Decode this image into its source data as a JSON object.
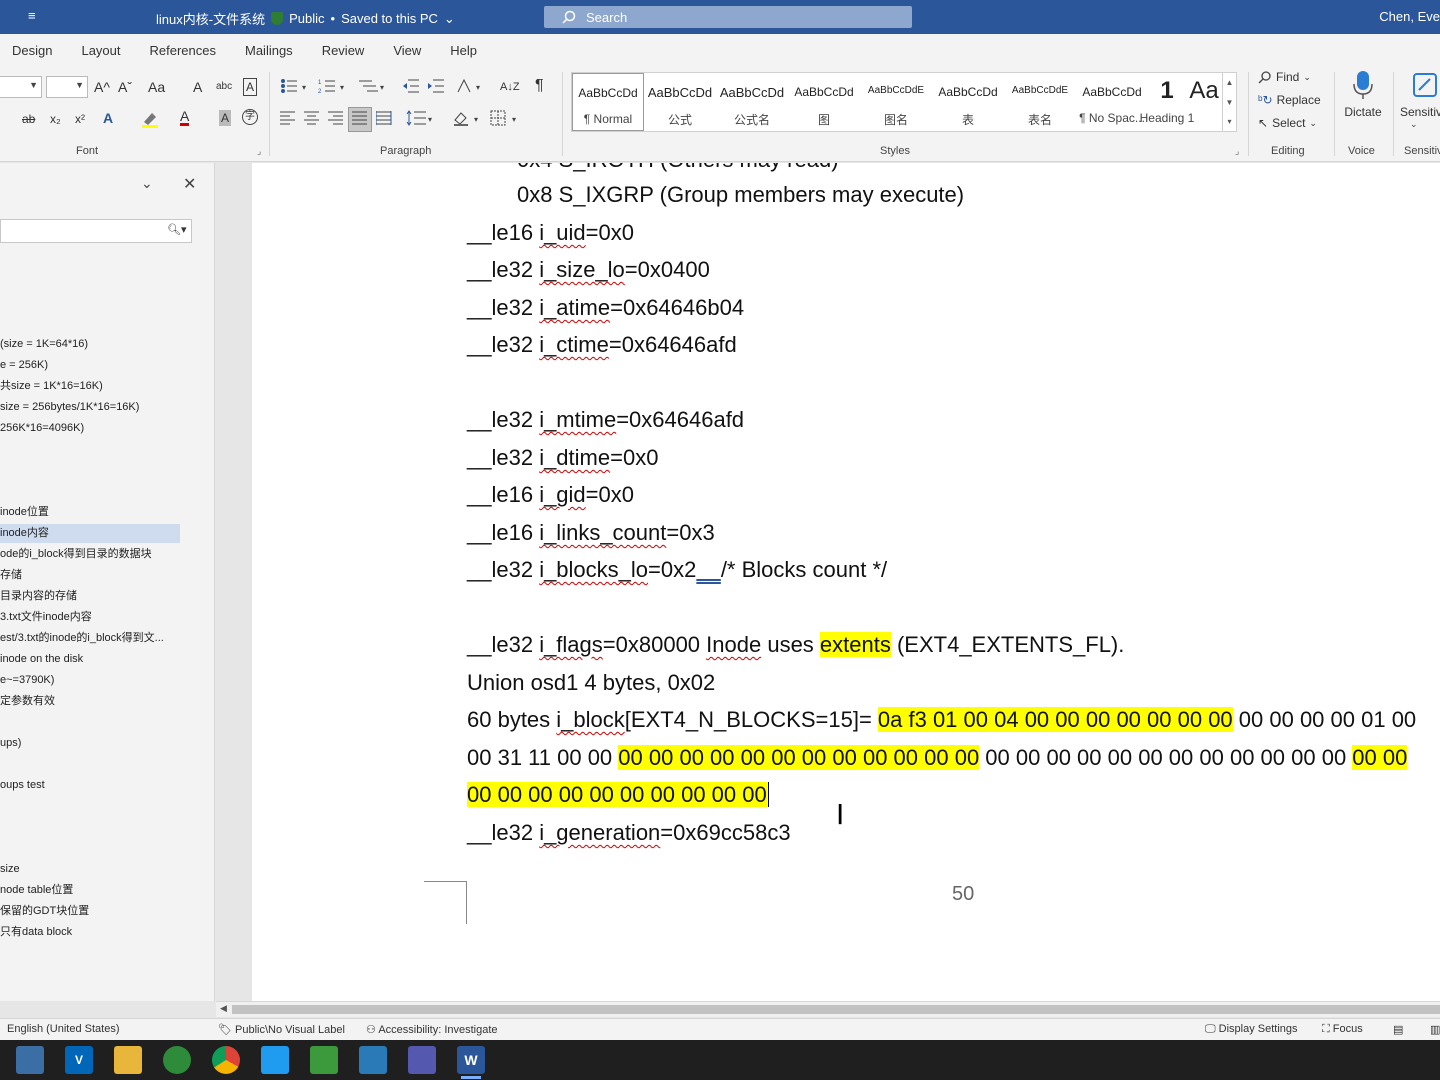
{
  "titlebar": {
    "menu_glyph": "≡",
    "doc_title": "linux内核-文件系统",
    "sensitivity": "Public",
    "save_status": "Saved to this PC",
    "search_placeholder": "Search",
    "user": "Chen, Eve"
  },
  "tabs": [
    "Design",
    "Layout",
    "References",
    "Mailings",
    "Review",
    "View",
    "Help"
  ],
  "ribbon": {
    "groups": {
      "font": "Font",
      "paragraph": "Paragraph",
      "styles": "Styles",
      "editing": "Editing",
      "voice": "Voice",
      "sensitivity": "Sensitivity"
    },
    "font_buttons": {
      "grow": "A^",
      "shrink": "Aˇ",
      "case": "Aa",
      "clear": "A",
      "phonetic": "abc",
      "border": "A",
      "strike": "ab",
      "sub": "x₂",
      "sup": "x²",
      "effects": "A",
      "color": "A",
      "shade": "A",
      "enclose": "字"
    },
    "paragraph_buttons": {
      "sort": "A↓Z",
      "pilcrow": "¶"
    },
    "styles": [
      {
        "preview": "AaBbCcDd",
        "name": "¶ Normal"
      },
      {
        "preview": "AaBbCcDd",
        "name": "公式"
      },
      {
        "preview": "AaBbCcDd",
        "name": "公式名"
      },
      {
        "preview": "AaBbCcDd",
        "name": "图"
      },
      {
        "preview": "AaBbCcDdE",
        "name": "图名"
      },
      {
        "preview": "AaBbCcDd",
        "name": "表"
      },
      {
        "preview": "AaBbCcDdE",
        "name": "表名"
      },
      {
        "preview": "AaBbCcDd",
        "name": "¶ No Spac..."
      },
      {
        "preview": "1",
        "name": "Heading 1"
      },
      {
        "preview": "Aa",
        "name": ""
      }
    ],
    "editing": {
      "find": "Find",
      "replace": "Replace",
      "select": "Select"
    },
    "voice": {
      "dictate": "Dictate"
    },
    "sensitivity_label": "Sensitiv"
  },
  "navpane": {
    "items": [
      {
        "text": "(size = 1K=64*16)"
      },
      {
        "text": "e = 256K)"
      },
      {
        "text": "共size = 1K*16=16K)"
      },
      {
        "text": "size = 256bytes/1K*16=16K)"
      },
      {
        "text": "256K*16=4096K)"
      },
      {
        "text": "inode位置"
      },
      {
        "text": "inode内容"
      },
      {
        "text": "ode的i_block得到目录的数据块"
      },
      {
        "text": "存储"
      },
      {
        "text": "目录内容的存储"
      },
      {
        "text": "3.txt文件inode内容"
      },
      {
        "text": "est/3.txt的inode的i_block得到文..."
      },
      {
        "text": "inode on the disk"
      },
      {
        "text": "e~=3790K)"
      },
      {
        "text": "定参数有效"
      },
      {
        "text": "ups)"
      },
      {
        "text": "oups test"
      },
      {
        "text": "size"
      },
      {
        "text": "node table位置"
      },
      {
        "text": "保留的GDT块位置"
      },
      {
        "text": "只有data block"
      }
    ],
    "selected_index": 6
  },
  "document": {
    "line_irgrp_partial": "0x4  S_IROTH (Others may read)",
    "line_ixgrp": "0x8  S_IXGRP (Group members may execute)",
    "uid": {
      "type": "__le16 ",
      "field": "i_uid",
      "value": "=0x0"
    },
    "size_lo": {
      "type": "__le32 ",
      "field": "i_size_lo",
      "value": "=0x0400"
    },
    "atime": {
      "type": "__le32 ",
      "field": "i_atime",
      "value": "=0x64646b04"
    },
    "ctime": {
      "type": "__le32 ",
      "field": "i_ctime",
      "value": "=0x64646afd"
    },
    "mtime": {
      "type": "__le32 ",
      "field": "i_mtime",
      "value": "=0x64646afd"
    },
    "dtime": {
      "type": "__le32 ",
      "field": "i_dtime",
      "value": "=0x0"
    },
    "gid": {
      "type": "__le16 ",
      "field": "i_gid",
      "value": "=0x0"
    },
    "links": {
      "type": "__le16 ",
      "field": "i_links_count",
      "value": "=0x3"
    },
    "blocks": {
      "type": "__le32 ",
      "field": "i_blocks_lo",
      "value": "=0x2",
      "gap": "    ",
      "comment": "/* Blocks count */"
    },
    "flags": {
      "type": "__le32 ",
      "field": "i_flags",
      "value": "=0x80000 ",
      "inode": "Inode",
      "uses": " uses ",
      "extents": "extents",
      "tail": " (EXT4_EXTENTS_FL)."
    },
    "osd1": "Union osd1 4 bytes, 0x02",
    "iblock": {
      "lead": "60 bytes ",
      "field": "i_block",
      "decl": "[EXT4_N_BLOCKS=15]= ",
      "hl1": "0a f3 01 00 04 00 00 00 00 00 00 00",
      "plain1": " 00 00 00 00 01 00",
      "plain2": "00 31 11 00 00 ",
      "hl2": "00 00 00 00 00 00 00 00 00 00 00 00",
      "plain3": " 00 00 00 00 00 00 00 00 00 00 00 00 ",
      "hl3": "00 00",
      "hl4": "00 00 00 00 00 00 00 00 00 00"
    },
    "generation": {
      "type": "__le32 ",
      "field": "i_generation",
      "value": "=0x69cc58c3"
    },
    "page_number": "50"
  },
  "statusbar": {
    "language": "English (United States)",
    "label": "Public\\No Visual Label",
    "accessibility": "Accessibility: Investigate",
    "display": "Display Settings",
    "focus": "Focus"
  },
  "colors": {
    "titlebar": "#2b579a",
    "highlight": "#ffff00",
    "taskbar": "#1f1f1f"
  }
}
